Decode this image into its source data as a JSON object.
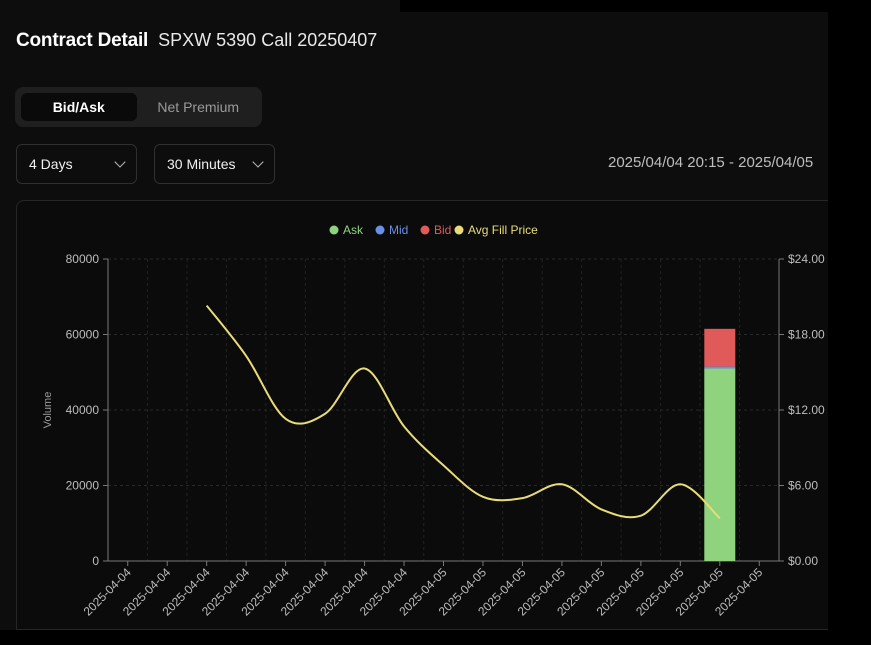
{
  "header": {
    "title": "Contract Detail",
    "subtitle": "SPXW 5390 Call 20250407"
  },
  "tabs": [
    {
      "label": "Bid/Ask",
      "active": true
    },
    {
      "label": "Net Premium",
      "active": false
    }
  ],
  "filters": {
    "period": "4 Days",
    "interval": "30 Minutes"
  },
  "date_range": "2025/04/04 20:15 - 2025/04/05",
  "colors": {
    "ask": "#8fd37e",
    "mid": "#6b8ee6",
    "bid": "#e05a5a",
    "avg_fill": "#e8dc78"
  },
  "chart_data": {
    "type": "bar",
    "title": "",
    "ylabel": "Volume",
    "legend": [
      "Ask",
      "Mid",
      "Bid",
      "Avg Fill Price"
    ],
    "legend_position": "top-center",
    "x_tick_labels": [
      "2025-04-04",
      "2025-04-04",
      "2025-04-04",
      "2025-04-04",
      "2025-04-04",
      "2025-04-04",
      "2025-04-04",
      "2025-04-04",
      "2025-04-05",
      "2025-04-05",
      "2025-04-05",
      "2025-04-05",
      "2025-04-05",
      "2025-04-05",
      "2025-04-05",
      "2025-04-05",
      "2025-04-05"
    ],
    "y_left": {
      "min": 0,
      "max": 80000,
      "ticks": [
        "0",
        "20000",
        "40000",
        "60000",
        "80000"
      ]
    },
    "y_right": {
      "min": 0,
      "max": 24,
      "ticks": [
        "$0.00",
        "$6.00",
        "$12.00",
        "$18.00",
        "$24.00"
      ]
    },
    "bars": {
      "index": 15,
      "ask": 51000,
      "mid": 500,
      "bid": 10000
    },
    "avg_fill_price": [
      {
        "i": 2,
        "y": 20.3
      },
      {
        "i": 3,
        "y": 16.3
      },
      {
        "i": 4,
        "y": 11.3
      },
      {
        "i": 5,
        "y": 11.7
      },
      {
        "i": 6,
        "y": 15.3
      },
      {
        "i": 7,
        "y": 10.7
      },
      {
        "i": 8,
        "y": 7.6
      },
      {
        "i": 9,
        "y": 5.1
      },
      {
        "i": 10,
        "y": 5.0
      },
      {
        "i": 11,
        "y": 6.1
      },
      {
        "i": 12,
        "y": 4.1
      },
      {
        "i": 13,
        "y": 3.6
      },
      {
        "i": 14,
        "y": 6.1
      },
      {
        "i": 15,
        "y": 3.4
      }
    ],
    "grid": true
  }
}
